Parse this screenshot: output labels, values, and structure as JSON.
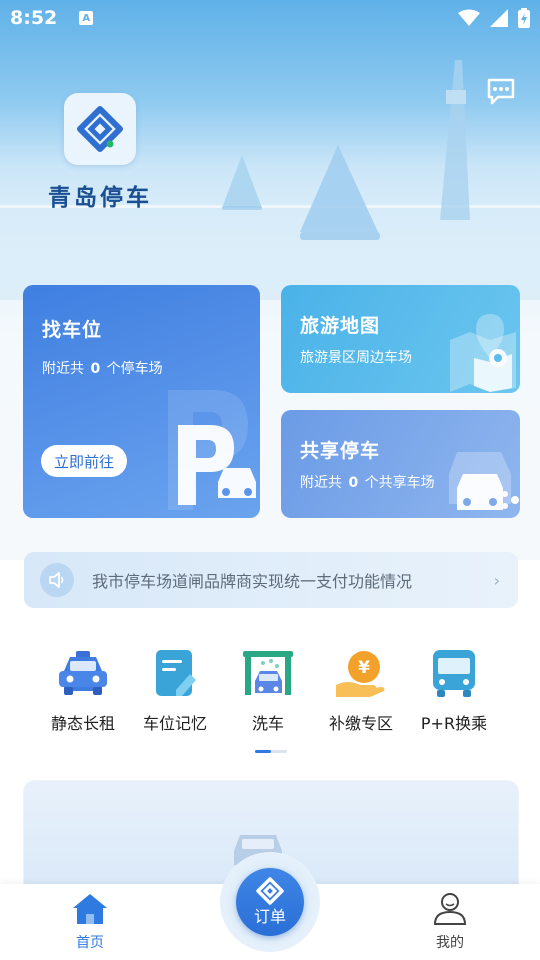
{
  "status_bar": {
    "time": "8:52",
    "notif_badge": "A"
  },
  "header": {
    "app_title": "青岛停车"
  },
  "cards": {
    "find": {
      "title": "找车位",
      "sub_prefix": "附近共",
      "count": "0",
      "sub_suffix": "个停车场",
      "button": "立即前往"
    },
    "map": {
      "title": "旅游地图",
      "sub": "旅游景区周边车场"
    },
    "share": {
      "title": "共享停车",
      "sub_prefix": "附近共",
      "count": "0",
      "sub_suffix": "个共享车场"
    }
  },
  "notice": {
    "text": "我市停车场道闸品牌商实现统一支付功能情况"
  },
  "services": [
    {
      "label": "静态长租",
      "icon": "taxi-icon"
    },
    {
      "label": "车位记忆",
      "icon": "note-edit-icon"
    },
    {
      "label": "洗车",
      "icon": "car-wash-icon"
    },
    {
      "label": "补缴专区",
      "icon": "yuan-hand-icon"
    },
    {
      "label": "P+R换乘",
      "icon": "bus-icon"
    }
  ],
  "tabbar": {
    "home": "首页",
    "order": "订单",
    "mine": "我的"
  },
  "colors": {
    "primary": "#2f7ae0",
    "title": "#1a4f94"
  }
}
